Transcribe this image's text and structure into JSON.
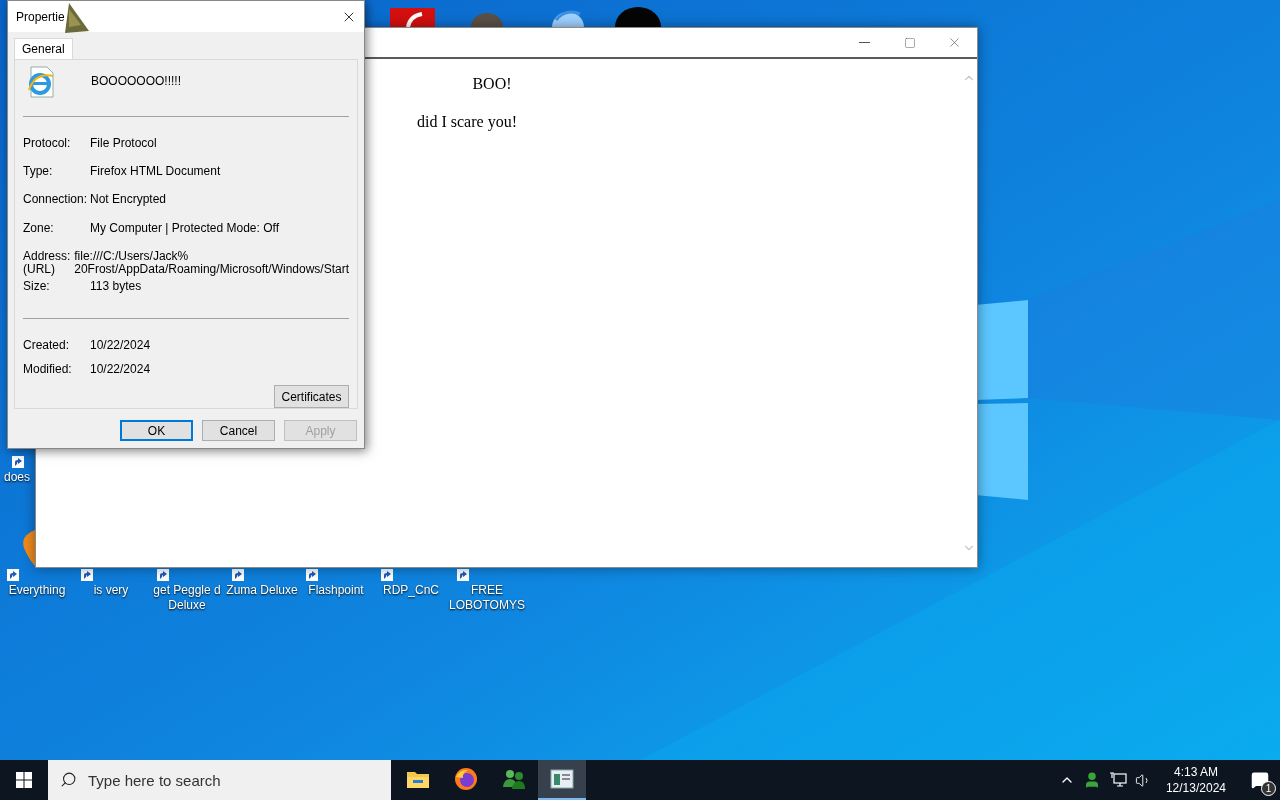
{
  "desktop": {
    "icons": [
      {
        "label": "does",
        "kind": "side"
      },
      {
        "label": "Everything",
        "kind": "bottom"
      },
      {
        "label": "is very",
        "kind": "bottom"
      },
      {
        "label": "get Peggle d Deluxe",
        "kind": "bottom"
      },
      {
        "label": "Zuma Deluxe",
        "kind": "bottom"
      },
      {
        "label": "Flashpoint",
        "kind": "bottom"
      },
      {
        "label": "RDP_CnC",
        "kind": "bottom"
      },
      {
        "label": "FREE LOBOTOMYS",
        "kind": "bottom"
      }
    ]
  },
  "browser_window": {
    "heading": "BOO!",
    "text": "did I scare you!"
  },
  "properties_dialog": {
    "title": "Propertie",
    "tabs": [
      {
        "label": "General",
        "selected": true
      }
    ],
    "file_name": "BOOOOOOO!!!!!",
    "fields": [
      {
        "label": "Protocol:",
        "value": "File Protocol"
      },
      {
        "label": "Type:",
        "value": "Firefox HTML Document"
      },
      {
        "label": "Connection:",
        "value": "Not Encrypted"
      },
      {
        "label": "Zone:",
        "value": "My Computer | Protected Mode: Off"
      },
      {
        "label": "Address:\n(URL)",
        "value": "file:///C:/Users/Jack%\n20Frost/AppData/Roaming/Microsoft/Windows/Start"
      },
      {
        "label": "Size:",
        "value": "113 bytes"
      }
    ],
    "dates": [
      {
        "label": "Created:",
        "value": "10/22/2024"
      },
      {
        "label": "Modified:",
        "value": "10/22/2024"
      }
    ],
    "certificates_button": "Certificates",
    "buttons": [
      {
        "label": "OK",
        "focused": true,
        "disabled": false
      },
      {
        "label": "Cancel",
        "focused": false,
        "disabled": false
      },
      {
        "label": "Apply",
        "focused": false,
        "disabled": true
      }
    ]
  },
  "taskbar": {
    "search": {
      "placeholder": "Type here to search"
    },
    "apps": [
      {
        "kind": "folder",
        "active": false
      },
      {
        "kind": "browser",
        "active": false
      },
      {
        "kind": "people",
        "active": false
      },
      {
        "kind": "window",
        "active": true
      }
    ],
    "clock": {
      "time": "4:13 AM",
      "date": "12/13/2024"
    },
    "notifications": {
      "count": "1"
    }
  }
}
